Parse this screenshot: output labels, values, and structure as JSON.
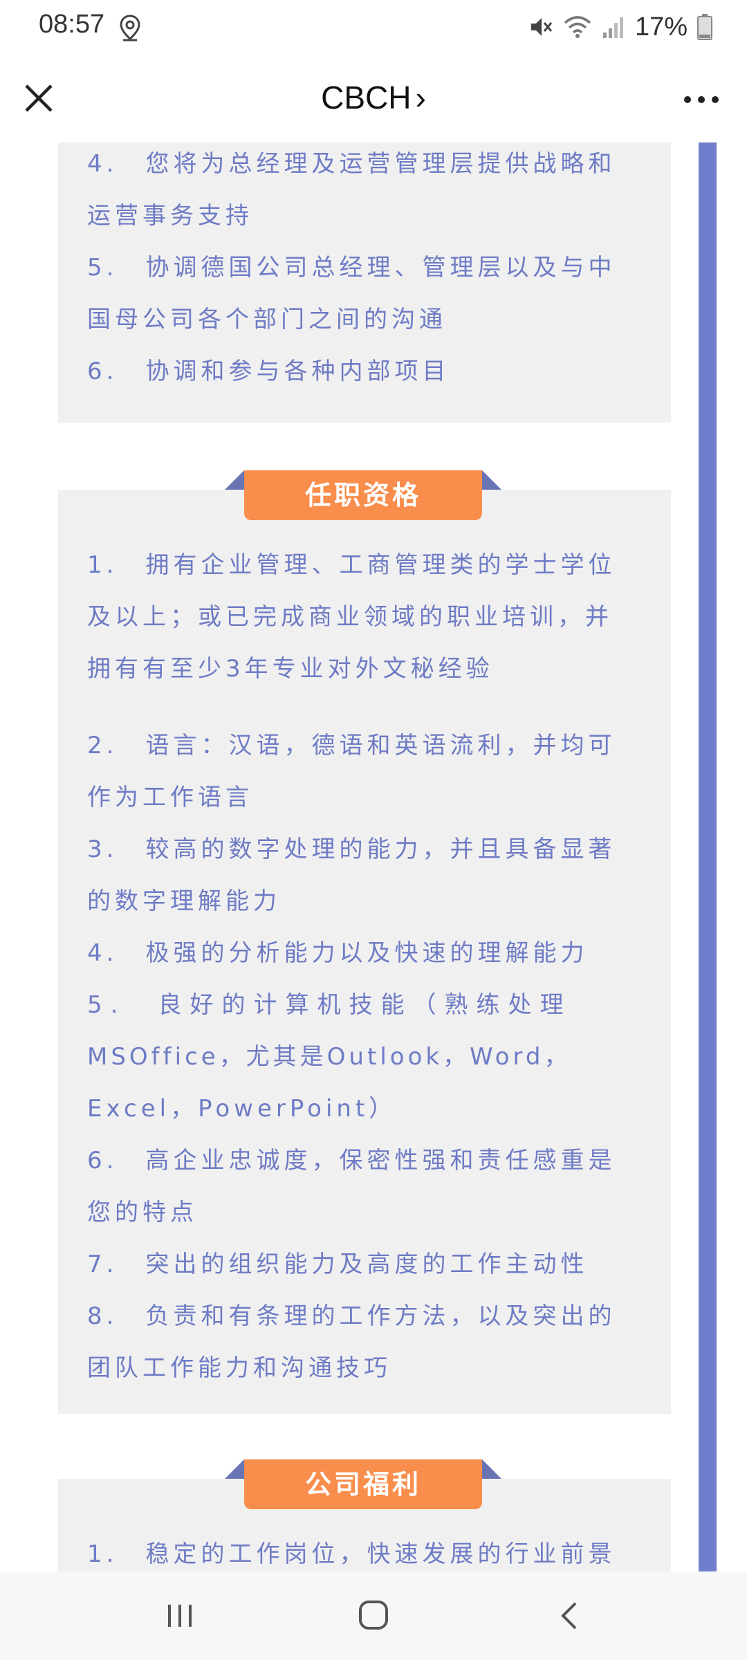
{
  "status_bar": {
    "time": "08:57",
    "battery": "17%"
  },
  "header": {
    "title": "CBCH",
    "chevron": "›"
  },
  "section_top": {
    "lines": [
      "4.　您将为总经理及运营管理层提供战略和",
      "运营事务支持",
      "5.　协调德国公司总经理、管理层以及与中",
      "国母公司各个部门之间的沟通",
      "6.　协调和参与各种内部项目"
    ]
  },
  "section_qualifications": {
    "tab": "任职资格",
    "lines_a": [
      "1.　拥有企业管理、工商管理类的学士学位",
      "及以上；或已完成商业领域的职业培训，并",
      "拥有有至少3年专业对外文秘经验"
    ],
    "lines_b": [
      "2.　语言：汉语，德语和英语流利，并均可",
      "作为工作语言",
      "3.　较高的数字处理的能力，并且具备显著",
      "的数字理解能力",
      "4.　极强的分析能力以及快速的理解能力",
      "5.　良好的计算机技能（熟练处理",
      "MSOffice，尤其是Outlook，Word，",
      "Excel，PowerPoint）",
      "6.　高企业忠诚度，保密性强和责任感重是",
      "您的特点",
      "7.　突出的组织能力及高度的工作主动性",
      "8.　负责和有条理的工作方法，以及突出的",
      "团队工作能力和沟通技巧"
    ]
  },
  "section_benefits": {
    "tab": "公司福利",
    "lines": [
      "1.　稳定的工作岗位，快速发展的行业前景"
    ]
  },
  "icons": {
    "close": "close-icon",
    "more": "more-icon",
    "location": "location-icon",
    "mute": "mute-icon",
    "wifi": "wifi-icon",
    "signal": "signal-icon",
    "battery": "battery-icon",
    "nav_recent": "recent-apps-icon",
    "nav_home": "home-icon",
    "nav_back": "back-icon"
  },
  "colors": {
    "accent_tab": "#f98e4c",
    "text_blue": "#6e7bc5",
    "scroll": "#6f7fcd",
    "card_bg": "#f0f0f0"
  }
}
